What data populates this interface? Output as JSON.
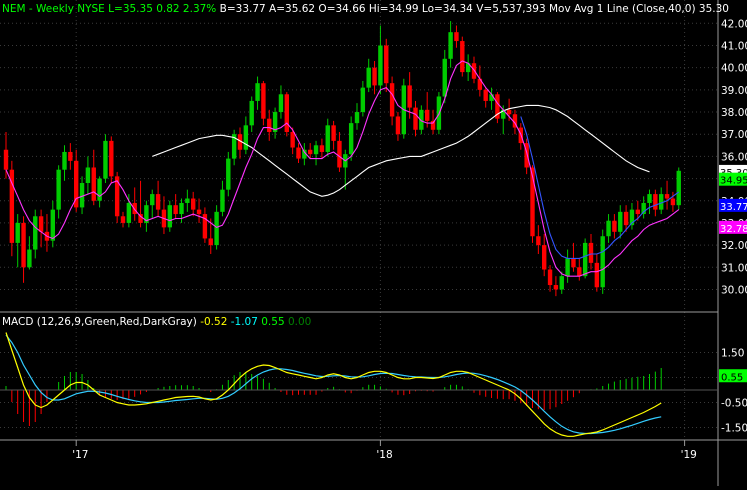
{
  "header": {
    "items": [
      {
        "text": "NEM - Weekly  NYSE",
        "color": "#00ff00"
      },
      {
        "text": "L=35.35",
        "color": "#00ff00"
      },
      {
        "text": "0.82",
        "color": "#00ff00"
      },
      {
        "text": "2.37%",
        "color": "#00ff00"
      },
      {
        "text": "B=33.77",
        "color": "#ffffff"
      },
      {
        "text": "A=35.62",
        "color": "#ffffff"
      },
      {
        "text": "O=34.66",
        "color": "#ffffff"
      },
      {
        "text": "Hi=34.99",
        "color": "#ffffff"
      },
      {
        "text": "Lo=34.34",
        "color": "#ffffff"
      },
      {
        "text": "V=5,537,393",
        "color": "#ffffff"
      },
      {
        "text": "Mov Avg 1 Line (Close,40,0)",
        "color": "#ffffff"
      },
      {
        "text": "35.30",
        "color": "#ffffff"
      }
    ]
  },
  "macd_header": {
    "items": [
      {
        "text": "MACD (12,26,9,Green,Red,DarkGray)",
        "color": "#ffffff"
      },
      {
        "text": "-0.52",
        "color": "#ffff00"
      },
      {
        "text": "-1.07",
        "color": "#00ffff"
      },
      {
        "text": "0.55",
        "color": "#00ff00"
      },
      {
        "text": "0.00",
        "color": "#008000"
      }
    ]
  },
  "colors": {
    "up": "#00cc00",
    "down": "#ff0000",
    "ma40": "#ffffff",
    "ma_short": "#ff33ff",
    "ma_mid": "#3355ff",
    "macd": "#ffff00",
    "signal": "#33ccff",
    "hist_pos": "#00cc00",
    "hist_neg": "#ff0000",
    "grid": "#3a3a3a"
  },
  "chart_data": [
    {
      "type": "candlestick",
      "title": "",
      "y_ticks": [
        30,
        31,
        32,
        33,
        34,
        35,
        36,
        37,
        38,
        39,
        40,
        41,
        42
      ],
      "y_tick_labels": [
        "30.00",
        "31.00",
        "32.00",
        "33.00",
        "34.00",
        "35.00",
        "36.00",
        "37.00",
        "38.00",
        "39.00",
        "40.00",
        "41.00",
        "42.00"
      ],
      "ylim": [
        29.3,
        42.6
      ],
      "x_ticks": [
        {
          "index": 12,
          "label": "'17"
        },
        {
          "index": 64,
          "label": "'18"
        },
        {
          "index": 116,
          "label": "'19"
        }
      ],
      "value_tags": [
        {
          "value": 35.3,
          "label": "35.30",
          "bg": "#ffffff",
          "fg": "#000000"
        },
        {
          "value": 34.95,
          "label": "34.95",
          "bg": "#00ff00",
          "fg": "#000000"
        },
        {
          "value": 33.77,
          "label": "33.77",
          "bg": "#0000ff",
          "fg": "#ffffff"
        },
        {
          "value": 32.78,
          "label": "32.78",
          "bg": "#ff00ff",
          "fg": "#ffffff"
        }
      ],
      "ohlc": [
        [
          36.3,
          37.1,
          35.0,
          35.4
        ],
        [
          35.4,
          35.8,
          31.5,
          32.1
        ],
        [
          32.1,
          33.4,
          31.0,
          33.0
        ],
        [
          33.0,
          33.3,
          30.3,
          31.0
        ],
        [
          31.0,
          32.4,
          30.9,
          31.8
        ],
        [
          31.8,
          33.6,
          31.4,
          33.3
        ],
        [
          33.3,
          33.6,
          31.9,
          32.6
        ],
        [
          32.6,
          33.4,
          31.7,
          32.2
        ],
        [
          32.2,
          34.0,
          31.9,
          33.6
        ],
        [
          33.6,
          35.6,
          33.2,
          35.4
        ],
        [
          35.4,
          36.5,
          34.9,
          36.2
        ],
        [
          36.2,
          36.6,
          35.4,
          35.8
        ],
        [
          35.8,
          36.3,
          33.5,
          33.7
        ],
        [
          33.7,
          35.1,
          33.4,
          34.8
        ],
        [
          34.8,
          36.0,
          34.3,
          35.5
        ],
        [
          35.5,
          36.3,
          33.8,
          34.0
        ],
        [
          34.0,
          35.1,
          33.7,
          35.0
        ],
        [
          35.0,
          37.0,
          34.8,
          36.7
        ],
        [
          36.7,
          36.9,
          34.8,
          35.1
        ],
        [
          35.1,
          35.3,
          33.0,
          33.3
        ],
        [
          33.3,
          33.5,
          32.8,
          33.0
        ],
        [
          33.0,
          34.3,
          32.8,
          33.9
        ],
        [
          33.9,
          34.6,
          33.1,
          33.4
        ],
        [
          33.4,
          34.9,
          32.8,
          33.0
        ],
        [
          33.0,
          34.0,
          32.6,
          33.8
        ],
        [
          33.8,
          34.5,
          33.2,
          34.3
        ],
        [
          34.3,
          34.9,
          33.3,
          33.6
        ],
        [
          33.6,
          34.2,
          32.5,
          32.8
        ],
        [
          32.8,
          34.0,
          32.6,
          33.8
        ],
        [
          33.8,
          34.3,
          33.2,
          33.4
        ],
        [
          33.4,
          34.1,
          33.0,
          33.9
        ],
        [
          33.9,
          34.5,
          33.5,
          34.1
        ],
        [
          34.1,
          34.4,
          33.3,
          33.6
        ],
        [
          33.6,
          34.1,
          33.0,
          33.4
        ],
        [
          33.4,
          33.7,
          32.1,
          32.3
        ],
        [
          32.3,
          33.2,
          31.6,
          32.0
        ],
        [
          32.0,
          33.8,
          31.8,
          33.5
        ],
        [
          33.5,
          34.9,
          33.3,
          34.5
        ],
        [
          34.5,
          36.2,
          34.2,
          35.9
        ],
        [
          35.9,
          37.2,
          35.6,
          37.0
        ],
        [
          37.0,
          37.3,
          35.9,
          36.3
        ],
        [
          36.3,
          37.8,
          36.1,
          37.4
        ],
        [
          37.4,
          38.7,
          37.1,
          38.5
        ],
        [
          38.5,
          39.6,
          38.1,
          39.3
        ],
        [
          39.3,
          39.4,
          37.4,
          37.7
        ],
        [
          37.7,
          38.1,
          36.7,
          37.1
        ],
        [
          37.1,
          38.2,
          36.8,
          38.0
        ],
        [
          38.0,
          39.2,
          37.7,
          38.8
        ],
        [
          38.8,
          38.9,
          36.9,
          37.1
        ],
        [
          37.1,
          37.3,
          36.1,
          36.4
        ],
        [
          36.4,
          36.6,
          35.7,
          35.9
        ],
        [
          35.9,
          36.6,
          35.6,
          36.3
        ],
        [
          36.3,
          36.6,
          35.9,
          36.1
        ],
        [
          36.1,
          36.7,
          35.6,
          36.5
        ],
        [
          36.5,
          36.8,
          35.9,
          36.2
        ],
        [
          36.2,
          37.7,
          36.0,
          37.4
        ],
        [
          37.4,
          37.6,
          36.3,
          36.7
        ],
        [
          36.7,
          37.1,
          35.3,
          35.5
        ],
        [
          35.5,
          36.3,
          34.5,
          36.1
        ],
        [
          36.1,
          37.8,
          35.8,
          37.5
        ],
        [
          37.5,
          38.4,
          37.2,
          38.0
        ],
        [
          38.0,
          39.4,
          37.8,
          39.1
        ],
        [
          39.1,
          40.4,
          38.9,
          40.0
        ],
        [
          40.0,
          40.3,
          38.8,
          39.2
        ],
        [
          39.2,
          41.9,
          38.8,
          41.0
        ],
        [
          41.0,
          41.3,
          38.9,
          39.3
        ],
        [
          39.3,
          39.6,
          37.4,
          37.8
        ],
        [
          37.8,
          38.0,
          36.7,
          37.0
        ],
        [
          37.0,
          39.5,
          36.8,
          39.2
        ],
        [
          39.2,
          39.8,
          37.7,
          38.2
        ],
        [
          38.2,
          38.5,
          36.9,
          37.2
        ],
        [
          37.2,
          38.3,
          37.0,
          38.1
        ],
        [
          38.1,
          38.9,
          37.3,
          37.6
        ],
        [
          37.6,
          38.1,
          37.0,
          37.2
        ],
        [
          37.2,
          38.9,
          37.0,
          38.7
        ],
        [
          38.7,
          40.8,
          38.4,
          40.4
        ],
        [
          40.4,
          42.1,
          40.0,
          41.6
        ],
        [
          41.6,
          41.9,
          40.9,
          41.2
        ],
        [
          41.2,
          41.4,
          39.6,
          39.8
        ],
        [
          39.8,
          40.6,
          39.4,
          40.2
        ],
        [
          40.2,
          40.5,
          39.3,
          39.5
        ],
        [
          39.5,
          40.1,
          38.7,
          39.0
        ],
        [
          39.0,
          39.1,
          38.2,
          38.5
        ],
        [
          38.5,
          39.1,
          38.1,
          38.8
        ],
        [
          38.8,
          38.9,
          37.5,
          37.7
        ],
        [
          37.7,
          38.3,
          37.0,
          38.1
        ],
        [
          38.1,
          38.6,
          37.6,
          37.9
        ],
        [
          37.9,
          38.1,
          37.0,
          37.3
        ],
        [
          37.3,
          37.5,
          36.3,
          36.6
        ],
        [
          36.6,
          36.8,
          35.2,
          35.5
        ],
        [
          35.5,
          35.6,
          32.1,
          32.4
        ],
        [
          32.4,
          32.9,
          31.6,
          32.0
        ],
        [
          32.0,
          32.5,
          30.6,
          30.9
        ],
        [
          30.9,
          31.1,
          29.9,
          30.2
        ],
        [
          30.2,
          30.6,
          29.7,
          30.0
        ],
        [
          30.0,
          30.8,
          29.8,
          30.6
        ],
        [
          30.6,
          31.8,
          30.3,
          31.4
        ],
        [
          31.4,
          32.1,
          30.8,
          31.0
        ],
        [
          31.0,
          31.4,
          30.4,
          30.6
        ],
        [
          30.6,
          32.3,
          30.5,
          32.1
        ],
        [
          32.1,
          32.5,
          30.9,
          31.2
        ],
        [
          31.2,
          31.6,
          29.9,
          30.1
        ],
        [
          30.1,
          32.7,
          29.8,
          32.4
        ],
        [
          32.4,
          33.4,
          32.1,
          33.1
        ],
        [
          33.1,
          33.4,
          32.3,
          32.6
        ],
        [
          32.6,
          33.8,
          32.3,
          33.5
        ],
        [
          33.5,
          33.8,
          32.6,
          32.9
        ],
        [
          32.9,
          33.9,
          32.7,
          33.6
        ],
        [
          33.6,
          34.0,
          33.1,
          33.4
        ],
        [
          33.4,
          34.2,
          33.2,
          33.9
        ],
        [
          33.9,
          34.5,
          33.4,
          34.3
        ],
        [
          34.3,
          34.5,
          33.3,
          33.6
        ],
        [
          33.6,
          34.6,
          33.4,
          34.3
        ],
        [
          34.3,
          34.9,
          33.6,
          34.1
        ],
        [
          34.1,
          34.4,
          33.5,
          33.8
        ],
        [
          33.8,
          35.5,
          33.6,
          35.35
        ]
      ],
      "ma40": [
        36.0,
        36.1,
        36.2,
        36.3,
        36.4,
        36.5,
        36.6,
        36.7,
        36.8,
        36.85,
        36.9,
        36.95,
        36.95,
        36.9,
        36.85,
        36.7,
        36.55,
        36.4,
        36.2,
        36.0,
        35.8,
        35.6,
        35.4,
        35.2,
        35.0,
        34.8,
        34.6,
        34.4,
        34.3,
        34.2,
        34.25,
        34.35,
        34.5,
        34.7,
        34.9,
        35.1,
        35.3,
        35.5,
        35.6,
        35.7,
        35.8,
        35.85,
        35.9,
        35.95,
        36.0,
        36.0,
        36.0,
        36.1,
        36.2,
        36.3,
        36.4,
        36.5,
        36.6,
        36.75,
        36.9,
        37.1,
        37.3,
        37.5,
        37.7,
        37.9,
        38.05,
        38.15,
        38.2,
        38.25,
        38.3,
        38.3,
        38.3,
        38.25,
        38.2,
        38.1,
        37.95,
        37.8,
        37.6,
        37.4,
        37.2,
        37.0,
        36.8,
        36.6,
        36.4,
        36.2,
        36.0,
        35.8,
        35.65,
        35.5,
        35.4,
        35.3
      ],
      "ma40_start": 25,
      "ma_short": [
        35.8,
        35.2,
        34.6,
        34.0,
        33.5,
        33.2,
        33.0,
        32.8,
        32.7,
        32.9,
        33.4,
        34.0,
        34.5,
        34.6,
        34.7,
        34.8,
        34.6,
        34.8,
        35.2,
        35.3,
        34.9,
        34.4,
        34.0,
        33.7,
        33.5,
        33.6,
        33.7,
        33.6,
        33.5,
        33.6,
        33.6,
        33.7,
        33.8,
        33.7,
        33.6,
        33.4,
        33.2,
        33.3,
        33.8,
        34.5,
        35.2,
        35.9,
        36.5,
        37.2,
        37.7,
        37.7,
        37.6,
        37.7,
        37.9,
        37.6,
        37.1,
        36.6,
        36.3,
        36.3,
        36.3,
        36.5,
        36.6,
        36.4,
        36.2,
        36.4,
        36.8,
        37.5,
        38.3,
        38.9,
        39.4,
        39.5,
        39.2,
        38.7,
        38.5,
        38.4,
        38.3,
        38.0,
        37.9,
        37.9,
        38.3,
        39.0,
        39.9,
        40.5,
        40.7,
        40.6,
        40.3,
        39.9,
        39.5,
        39.2,
        38.8,
        38.5,
        38.2,
        37.9,
        37.4,
        36.6,
        35.5,
        34.3,
        33.1,
        32.1,
        31.4,
        31.1,
        31.0,
        31.0,
        31.0,
        31.1,
        31.2,
        31.2,
        31.3,
        31.5,
        31.8,
        32.0,
        32.3,
        32.6,
        32.8,
        33.1,
        33.3,
        33.4,
        33.5,
        33.6,
        33.8,
        34.0
      ],
      "ma_short_offset": -0.4,
      "ma_mid_offset": 0.4,
      "ma_mid_start": 88
    },
    {
      "type": "macd",
      "title": "",
      "y_ticks": [
        1.5,
        0.5,
        -0.5,
        -1.5
      ],
      "y_tick_labels": [
        "1.50",
        "0.50",
        "-0.50",
        "-1.50"
      ],
      "ylim": [
        -2.0,
        2.4
      ],
      "value_tag": {
        "value": 0.55,
        "label": "0.55",
        "bg": "#00ff00",
        "fg": "#000000"
      },
      "macd": [
        2.3,
        1.6,
        0.9,
        0.2,
        -0.3,
        -0.6,
        -0.7,
        -0.6,
        -0.4,
        -0.2,
        0.0,
        0.2,
        0.3,
        0.3,
        0.2,
        0.0,
        -0.2,
        -0.3,
        -0.4,
        -0.5,
        -0.55,
        -0.6,
        -0.6,
        -0.58,
        -0.55,
        -0.5,
        -0.45,
        -0.4,
        -0.35,
        -0.3,
        -0.28,
        -0.26,
        -0.25,
        -0.28,
        -0.35,
        -0.4,
        -0.35,
        -0.2,
        0.0,
        0.25,
        0.5,
        0.7,
        0.85,
        0.95,
        1.0,
        0.98,
        0.9,
        0.8,
        0.7,
        0.65,
        0.6,
        0.55,
        0.5,
        0.45,
        0.5,
        0.6,
        0.65,
        0.6,
        0.5,
        0.45,
        0.5,
        0.6,
        0.7,
        0.75,
        0.75,
        0.7,
        0.6,
        0.5,
        0.45,
        0.45,
        0.5,
        0.5,
        0.48,
        0.46,
        0.5,
        0.6,
        0.7,
        0.75,
        0.75,
        0.7,
        0.6,
        0.5,
        0.4,
        0.3,
        0.2,
        0.1,
        0.0,
        -0.15,
        -0.35,
        -0.6,
        -0.85,
        -1.1,
        -1.35,
        -1.55,
        -1.7,
        -1.8,
        -1.85,
        -1.85,
        -1.8,
        -1.75,
        -1.72,
        -1.68,
        -1.6,
        -1.5,
        -1.4,
        -1.3,
        -1.2,
        -1.1,
        -1.0,
        -0.9,
        -0.78,
        -0.66,
        -0.52
      ],
      "signal": [
        2.2,
        1.9,
        1.5,
        1.0,
        0.6,
        0.2,
        -0.1,
        -0.3,
        -0.4,
        -0.4,
        -0.35,
        -0.25,
        -0.15,
        -0.1,
        -0.05,
        -0.05,
        -0.08,
        -0.12,
        -0.18,
        -0.25,
        -0.32,
        -0.38,
        -0.43,
        -0.47,
        -0.5,
        -0.5,
        -0.5,
        -0.48,
        -0.45,
        -0.42,
        -0.4,
        -0.38,
        -0.35,
        -0.33,
        -0.33,
        -0.35,
        -0.37,
        -0.33,
        -0.25,
        -0.12,
        0.05,
        0.25,
        0.45,
        0.6,
        0.72,
        0.8,
        0.85,
        0.85,
        0.82,
        0.78,
        0.72,
        0.67,
        0.62,
        0.57,
        0.54,
        0.55,
        0.57,
        0.58,
        0.56,
        0.53,
        0.52,
        0.53,
        0.57,
        0.62,
        0.66,
        0.67,
        0.66,
        0.62,
        0.58,
        0.55,
        0.53,
        0.52,
        0.51,
        0.5,
        0.5,
        0.53,
        0.57,
        0.62,
        0.66,
        0.68,
        0.67,
        0.63,
        0.57,
        0.5,
        0.42,
        0.33,
        0.23,
        0.12,
        -0.02,
        -0.2,
        -0.4,
        -0.62,
        -0.85,
        -1.07,
        -1.27,
        -1.45,
        -1.58,
        -1.67,
        -1.72,
        -1.74,
        -1.74,
        -1.72,
        -1.7,
        -1.66,
        -1.61,
        -1.55,
        -1.48,
        -1.41,
        -1.33,
        -1.25,
        -1.18,
        -1.12,
        -1.07
      ]
    }
  ]
}
